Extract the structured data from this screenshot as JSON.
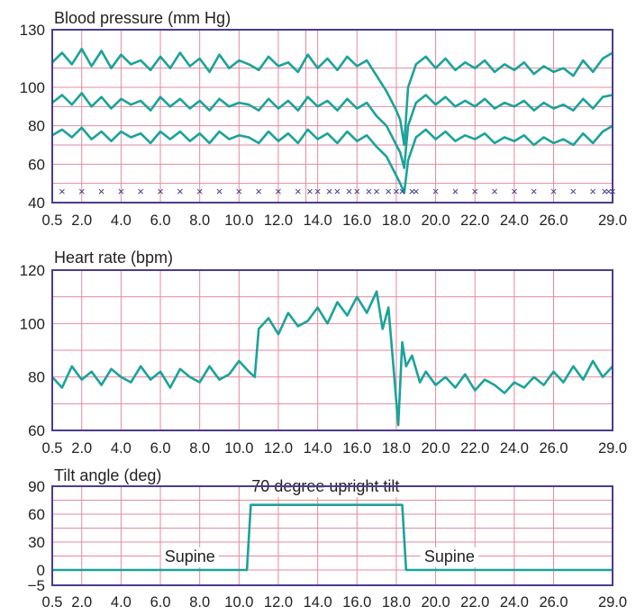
{
  "colors": {
    "frame": "#4b3b8f",
    "grid": "#e58a9c",
    "trace": "#1aa39a",
    "marker": "#3d3a8c",
    "text": "#231f20"
  },
  "chart_data": [
    {
      "type": "line",
      "title": "Blood pressure (mm Hg)",
      "xlim": [
        0.5,
        29.0
      ],
      "ylim": [
        40,
        130
      ],
      "x_ticks": [
        "0.5",
        "2.0",
        "4.0",
        "6.0",
        "8.0",
        "10.0",
        "12.0",
        "13.4",
        "14.0",
        "16.0",
        "18.0",
        "20.0",
        "22.0",
        "24.0",
        "26.0",
        "29.0"
      ],
      "x_tick_values": [
        0.5,
        2.0,
        4.0,
        6.0,
        8.0,
        10.0,
        12.0,
        13.4,
        14.0,
        16.0,
        18.0,
        20.0,
        22.0,
        24.0,
        26.0,
        29.0
      ],
      "x_tick_labels": [
        "0.5",
        "2.0",
        "4.0",
        "6.0",
        "8.0",
        "10.0",
        "12.0",
        "",
        "14.0",
        "16.0",
        "18.0",
        "20.0",
        "22.0",
        "24.0",
        "26.0",
        "29.0"
      ],
      "y_ticks": [
        "130",
        "100",
        "80",
        "60",
        "40"
      ],
      "y_tick_values": [
        130,
        100,
        80,
        60,
        40
      ],
      "grid": true,
      "marker_symbol": "×",
      "marker_y": 46,
      "marker_x": [
        1.0,
        2.0,
        3.0,
        4.0,
        5.0,
        6.0,
        7.0,
        8.0,
        9.0,
        10.0,
        11.0,
        12.0,
        13.0,
        13.6,
        14.0,
        14.6,
        15.0,
        15.6,
        16.0,
        16.6,
        17.0,
        17.6,
        18.0,
        18.3,
        18.8,
        19.0,
        20.0,
        21.0,
        22.0,
        23.0,
        24.0,
        25.0,
        26.0,
        27.0,
        28.0,
        28.6,
        28.8,
        29.0
      ],
      "series": [
        {
          "role": "systolic",
          "x": [
            0.5,
            1.0,
            1.5,
            2.0,
            2.5,
            3.0,
            3.5,
            4.0,
            4.5,
            5.0,
            5.5,
            6.0,
            6.5,
            7.0,
            7.5,
            8.0,
            8.5,
            9.0,
            9.5,
            10.0,
            10.5,
            11.0,
            11.5,
            12.0,
            12.5,
            13.0,
            13.5,
            14.0,
            14.5,
            15.0,
            15.5,
            16.0,
            16.5,
            17.0,
            17.5,
            17.8,
            18.0,
            18.2,
            18.4,
            18.6,
            19.0,
            19.5,
            20.0,
            20.5,
            21.0,
            21.5,
            22.0,
            22.5,
            23.0,
            23.5,
            24.0,
            24.5,
            25.0,
            25.5,
            26.0,
            26.5,
            27.0,
            27.5,
            28.0,
            28.5,
            29.0
          ],
          "values": [
            113,
            118,
            112,
            120,
            111,
            119,
            110,
            117,
            112,
            114,
            109,
            116,
            110,
            118,
            111,
            115,
            108,
            117,
            110,
            114,
            112,
            109,
            116,
            111,
            113,
            108,
            117,
            110,
            115,
            109,
            116,
            111,
            114,
            106,
            98,
            92,
            88,
            83,
            70,
            100,
            112,
            116,
            110,
            115,
            109,
            113,
            110,
            114,
            108,
            112,
            109,
            113,
            107,
            111,
            108,
            110,
            106,
            114,
            108,
            115,
            118
          ]
        },
        {
          "role": "mean",
          "x": [
            0.5,
            1.0,
            1.5,
            2.0,
            2.5,
            3.0,
            3.5,
            4.0,
            4.5,
            5.0,
            5.5,
            6.0,
            6.5,
            7.0,
            7.5,
            8.0,
            8.5,
            9.0,
            9.5,
            10.0,
            10.5,
            11.0,
            11.5,
            12.0,
            12.5,
            13.0,
            13.5,
            14.0,
            14.5,
            15.0,
            15.5,
            16.0,
            16.5,
            17.0,
            17.5,
            17.8,
            18.0,
            18.2,
            18.4,
            18.6,
            19.0,
            19.5,
            20.0,
            20.5,
            21.0,
            21.5,
            22.0,
            22.5,
            23.0,
            23.5,
            24.0,
            24.5,
            25.0,
            25.5,
            26.0,
            26.5,
            27.0,
            27.5,
            28.0,
            28.5,
            29.0
          ],
          "values": [
            92,
            96,
            91,
            97,
            90,
            95,
            89,
            94,
            91,
            93,
            88,
            95,
            90,
            94,
            89,
            93,
            88,
            94,
            90,
            92,
            91,
            88,
            94,
            89,
            93,
            88,
            95,
            90,
            93,
            88,
            94,
            89,
            92,
            85,
            80,
            74,
            70,
            66,
            58,
            80,
            92,
            96,
            91,
            95,
            90,
            93,
            90,
            94,
            89,
            92,
            90,
            93,
            88,
            92,
            89,
            91,
            88,
            94,
            89,
            95,
            96
          ]
        },
        {
          "role": "diastolic",
          "x": [
            0.5,
            1.0,
            1.5,
            2.0,
            2.5,
            3.0,
            3.5,
            4.0,
            4.5,
            5.0,
            5.5,
            6.0,
            6.5,
            7.0,
            7.5,
            8.0,
            8.5,
            9.0,
            9.5,
            10.0,
            10.5,
            11.0,
            11.5,
            12.0,
            12.5,
            13.0,
            13.5,
            14.0,
            14.5,
            15.0,
            15.5,
            16.0,
            16.5,
            17.0,
            17.5,
            17.8,
            18.0,
            18.2,
            18.4,
            18.6,
            19.0,
            19.5,
            20.0,
            20.5,
            21.0,
            21.5,
            22.0,
            22.5,
            23.0,
            23.5,
            24.0,
            24.5,
            25.0,
            25.5,
            26.0,
            26.5,
            27.0,
            27.5,
            28.0,
            28.5,
            29.0
          ],
          "values": [
            75,
            78,
            74,
            79,
            73,
            77,
            72,
            77,
            74,
            76,
            71,
            77,
            73,
            77,
            72,
            76,
            71,
            77,
            73,
            75,
            74,
            71,
            77,
            72,
            76,
            71,
            78,
            73,
            76,
            71,
            77,
            72,
            75,
            69,
            64,
            58,
            54,
            50,
            45,
            62,
            74,
            78,
            73,
            77,
            72,
            75,
            73,
            76,
            71,
            74,
            72,
            75,
            70,
            74,
            71,
            73,
            70,
            76,
            71,
            77,
            80
          ]
        }
      ]
    },
    {
      "type": "line",
      "title": "Heart rate (bpm)",
      "xlim": [
        0.5,
        29.0
      ],
      "ylim": [
        60,
        120
      ],
      "x_ticks": [
        "0.5",
        "2.0",
        "4.0",
        "6.0",
        "8.0",
        "10.0",
        "12.0",
        "14.0",
        "16.0",
        "18.0",
        "20.0",
        "22.0",
        "24.0",
        "26.0",
        "29.0"
      ],
      "x_tick_values": [
        0.5,
        2.0,
        4.0,
        6.0,
        8.0,
        10.0,
        12.0,
        14.0,
        16.0,
        18.0,
        20.0,
        22.0,
        24.0,
        26.0,
        29.0
      ],
      "y_ticks": [
        "120",
        "100",
        "80",
        "60"
      ],
      "y_tick_values": [
        120,
        100,
        80,
        60
      ],
      "grid": true,
      "series": [
        {
          "role": "heart-rate",
          "x": [
            0.5,
            1.0,
            1.5,
            2.0,
            2.5,
            3.0,
            3.5,
            4.0,
            4.5,
            5.0,
            5.5,
            6.0,
            6.5,
            7.0,
            7.5,
            8.0,
            8.5,
            9.0,
            9.5,
            10.0,
            10.5,
            10.8,
            11.0,
            11.5,
            12.0,
            12.5,
            13.0,
            13.5,
            14.0,
            14.5,
            15.0,
            15.5,
            16.0,
            16.5,
            17.0,
            17.3,
            17.6,
            17.9,
            18.1,
            18.3,
            18.5,
            18.8,
            19.2,
            19.5,
            20.0,
            20.5,
            21.0,
            21.5,
            22.0,
            22.5,
            23.0,
            23.5,
            24.0,
            24.5,
            25.0,
            25.5,
            26.0,
            26.5,
            27.0,
            27.5,
            28.0,
            28.5,
            29.0
          ],
          "values": [
            80,
            76,
            84,
            79,
            82,
            77,
            83,
            80,
            78,
            84,
            79,
            82,
            76,
            83,
            80,
            78,
            84,
            79,
            81,
            86,
            82,
            80,
            98,
            102,
            96,
            104,
            99,
            101,
            106,
            100,
            108,
            103,
            110,
            104,
            112,
            98,
            106,
            80,
            62,
            93,
            84,
            88,
            78,
            82,
            77,
            80,
            76,
            81,
            75,
            79,
            77,
            74,
            78,
            76,
            80,
            77,
            82,
            78,
            84,
            79,
            86,
            80,
            84
          ]
        }
      ]
    },
    {
      "type": "line",
      "title": "Tilt angle (deg)",
      "xlim": [
        0.5,
        29.0
      ],
      "ylim": [
        -5,
        90
      ],
      "x_ticks": [
        "0.5",
        "2.0",
        "4.0",
        "6.0",
        "8.0",
        "10.0",
        "12.0",
        "14.0",
        "16.0",
        "18.0",
        "20.0",
        "22.0",
        "24.0",
        "26.0",
        "29.0"
      ],
      "x_tick_values": [
        0.5,
        2.0,
        4.0,
        6.0,
        8.0,
        10.0,
        12.0,
        14.0,
        16.0,
        18.0,
        20.0,
        22.0,
        24.0,
        26.0,
        29.0
      ],
      "y_ticks": [
        "90",
        "60",
        "30",
        "0",
        "−5"
      ],
      "y_tick_values": [
        90,
        60,
        30,
        0,
        -5
      ],
      "grid": true,
      "series": [
        {
          "role": "tilt",
          "x": [
            0.5,
            10.4,
            10.6,
            18.3,
            18.5,
            29.0
          ],
          "values": [
            0,
            0,
            70,
            70,
            0,
            0
          ]
        }
      ],
      "annotations": [
        {
          "text": "70 degree upright tilt",
          "x": 14.4,
          "y": 90
        },
        {
          "text": "Supine",
          "x": 7.5,
          "y": 3
        },
        {
          "text": "Supine",
          "x": 20.7,
          "y": 3
        }
      ]
    }
  ]
}
